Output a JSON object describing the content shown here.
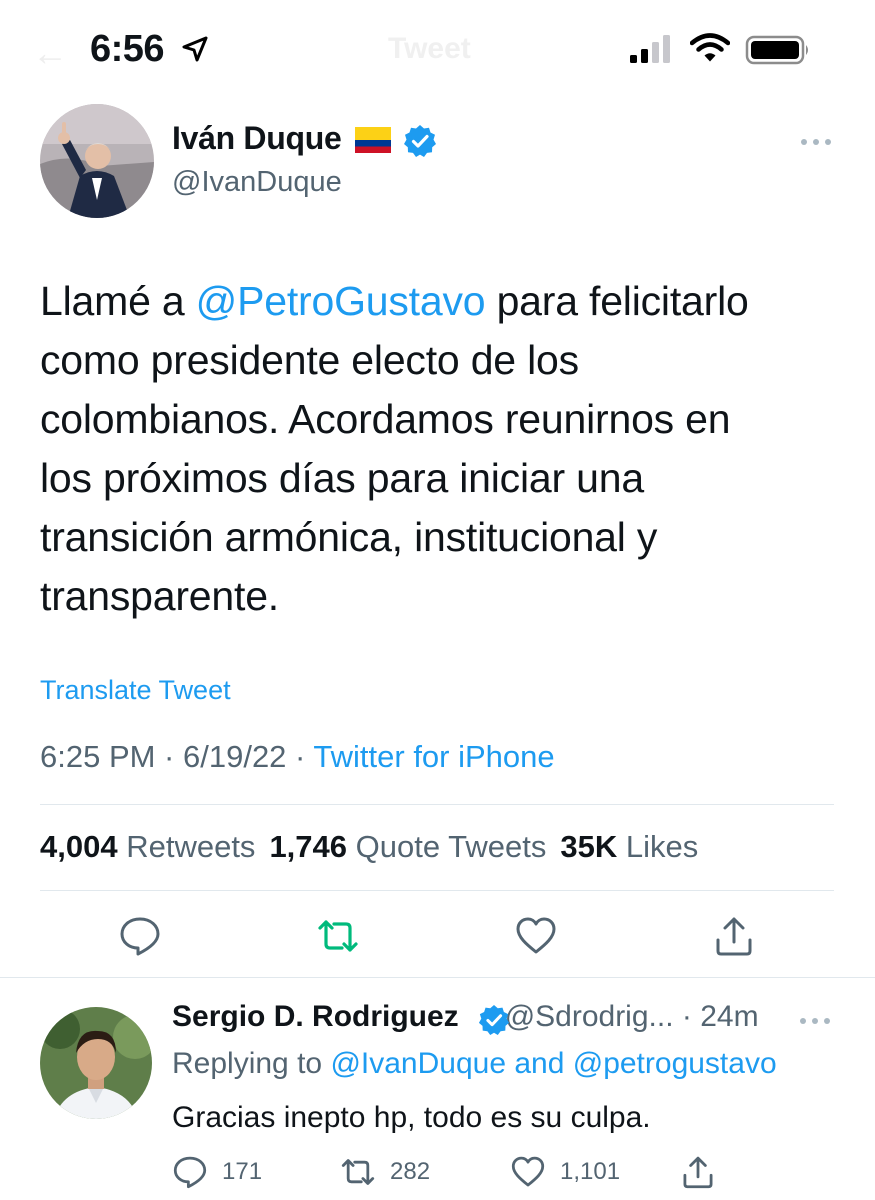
{
  "status_bar": {
    "time": "6:56",
    "ghost_back": "←",
    "ghost_title": "Tweet"
  },
  "tweet": {
    "author_name": "Iván Duque",
    "author_handle": "@IvanDuque",
    "text_before": "Llamé a ",
    "mention": "@PetroGustavo",
    "text_after": " para felicitarlo\ncomo presidente electo de los\ncolombianos. Acordamos reunirnos en\nlos próximos días para iniciar una\ntransición armónica, institucional y\ntransparente.",
    "translate_label": "Translate Tweet",
    "timestamp": "6:25 PM · 6/19/22 · ",
    "source": "Twitter for iPhone",
    "stats": {
      "retweets_count": "4,004",
      "retweets_label": "Retweets",
      "quotes_count": "1,746",
      "quotes_label": "Quote Tweets",
      "likes_count": "35K",
      "likes_label": "Likes"
    }
  },
  "reply": {
    "author_name": "Sergio D. Rodriguez",
    "author_handle": "@Sdrodrig...",
    "age": " · 24m",
    "replying_prefix": "Replying to ",
    "replying_user1": "@IvanDuque",
    "replying_and": " and ",
    "replying_user2": "@petrogustavo",
    "text": "Gracias inepto hp, todo es su culpa.",
    "reply_count": "171",
    "retweet_count": "282",
    "like_count": "1,101"
  },
  "colors": {
    "link": "#1d9bf0",
    "muted": "#536471",
    "text": "#0f1419",
    "retweet_green": "#00ba7c",
    "divider": "#e1e8ed"
  }
}
